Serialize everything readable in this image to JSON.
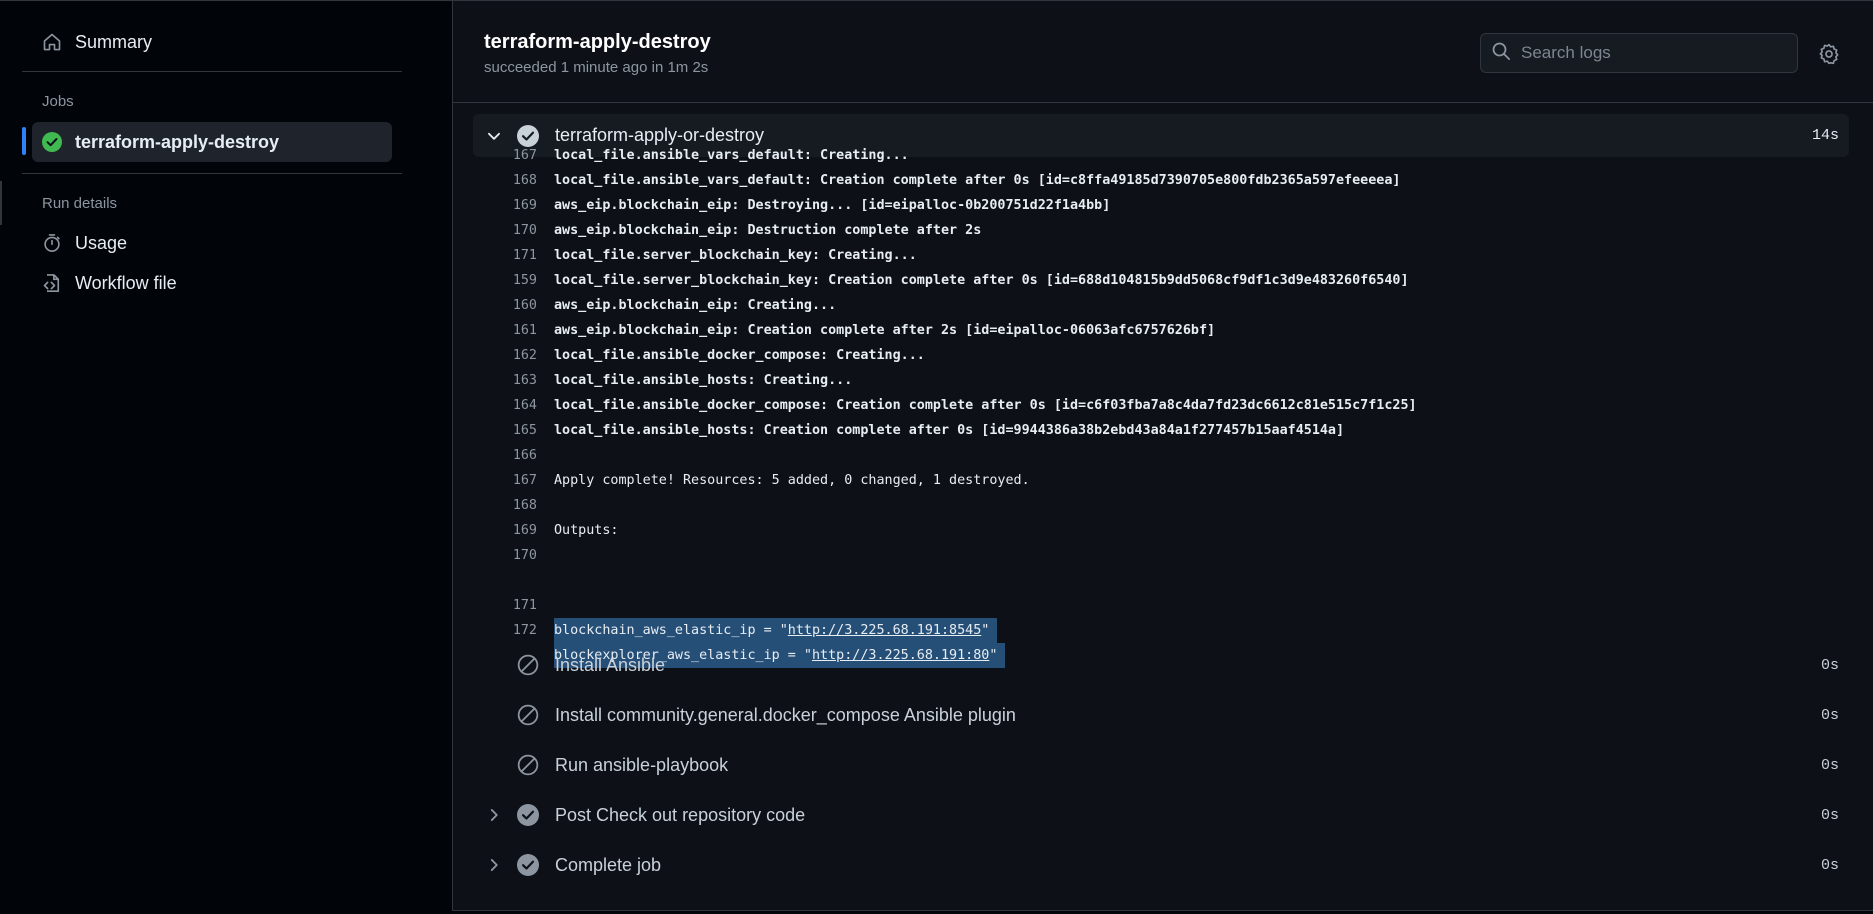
{
  "sidebar": {
    "summary_label": "Summary",
    "jobs_heading": "Jobs",
    "job_label": "terraform-apply-destroy",
    "run_details_heading": "Run details",
    "usage_label": "Usage",
    "workflow_label": "Workflow file"
  },
  "header": {
    "title": "terraform-apply-destroy",
    "subtitle": "succeeded 1 minute ago in 1m 2s",
    "search_placeholder": "Search logs"
  },
  "step": {
    "name": "terraform-apply-or-destroy",
    "duration": "14s"
  },
  "log_lines": [
    {
      "num": "167",
      "text": "local_file.ansible_vars_default: Creating..."
    },
    {
      "num": "168",
      "text": "local_file.ansible_vars_default: Creation complete after 0s [id=c8ffa49185d7390705e800fdb2365a597efeeeea]"
    },
    {
      "num": "169",
      "text": "aws_eip.blockchain_eip: Destroying... [id=eipalloc-0b200751d22f1a4bb]"
    },
    {
      "num": "170",
      "text": "aws_eip.blockchain_eip: Destruction complete after 2s"
    },
    {
      "num": "171",
      "text": "local_file.server_blockchain_key: Creating..."
    },
    {
      "num": "159",
      "text": "local_file.server_blockchain_key: Creation complete after 0s [id=688d104815b9dd5068cf9df1c3d9e483260f6540]"
    },
    {
      "num": "160",
      "text": "aws_eip.blockchain_eip: Creating..."
    },
    {
      "num": "161",
      "text": "aws_eip.blockchain_eip: Creation complete after 2s [id=eipalloc-06063afc6757626bf]"
    },
    {
      "num": "162",
      "text": "local_file.ansible_docker_compose: Creating..."
    },
    {
      "num": "163",
      "text": "local_file.ansible_hosts: Creating..."
    },
    {
      "num": "164",
      "text": "local_file.ansible_docker_compose: Creation complete after 0s [id=c6f03fba7a8c4da7fd23dc6612c81e515c7f1c25]"
    },
    {
      "num": "165",
      "text": "local_file.ansible_hosts: Creation complete after 0s [id=9944386a38b2ebd43a84a1f277457b15aaf4514a]"
    },
    {
      "num": "166",
      "text": ""
    },
    {
      "num": "167",
      "text": "Apply complete! Resources: 5 added, 0 changed, 1 destroyed."
    },
    {
      "num": "168",
      "text": ""
    },
    {
      "num": "169",
      "text": "Outputs:"
    },
    {
      "num": "170",
      "text": ""
    }
  ],
  "outputs": [
    {
      "num": "171",
      "prefix": "blockchain_aws_elastic_ip = \"",
      "url": "http://3.225.68.191:8545",
      "suffix": "\""
    },
    {
      "num": "172",
      "prefix": "blockexplorer_aws_elastic_ip = \"",
      "url": "http://3.225.68.191:80",
      "suffix": "\""
    }
  ],
  "steps": [
    {
      "name": "Install Ansible",
      "duration": "0s",
      "status": "skipped"
    },
    {
      "name": "Install community.general.docker_compose Ansible plugin",
      "duration": "0s",
      "status": "skipped"
    },
    {
      "name": "Run ansible-playbook",
      "duration": "0s",
      "status": "skipped"
    },
    {
      "name": "Post Check out repository code",
      "duration": "0s",
      "status": "success"
    },
    {
      "name": "Complete job",
      "duration": "0s",
      "status": "success"
    }
  ],
  "colors": {
    "accent": "#2f81f7",
    "success": "#3fb950",
    "selection": "#264f78"
  }
}
